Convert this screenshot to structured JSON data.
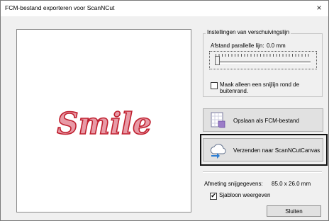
{
  "window": {
    "title": "FCM-bestand exporteren voor ScanNCut",
    "close_glyph": "×"
  },
  "preview": {
    "text": "Smile",
    "fill_color": "#e89aa6",
    "outline_color": "#c0202f"
  },
  "offset_settings": {
    "group_title": "Instellingen van verschuivingslijn",
    "distance_label": "Afstand parallelle lijn:",
    "distance_value": "0.0 mm",
    "distance_level": 0.0,
    "outer_edge_checkbox_label": "Maak alleen een snijlijn rond de buitenrand.",
    "outer_edge_checked": false
  },
  "buttons": {
    "save_label": "Opslaan als FCM-bestand",
    "send_label": "Verzenden naar ScanNCutCanvas",
    "close_label": "Sluiten"
  },
  "cut_data": {
    "size_label": "Afmeting snijgegevens:",
    "size_value": "85.0 x 26.0 mm",
    "template_checkbox_label": "Sjabloon weergeven",
    "template_checked": true,
    "check_glyph": "✔"
  },
  "icons": {
    "save": "fcm-file-icon",
    "send": "cloud-upload-icon"
  }
}
